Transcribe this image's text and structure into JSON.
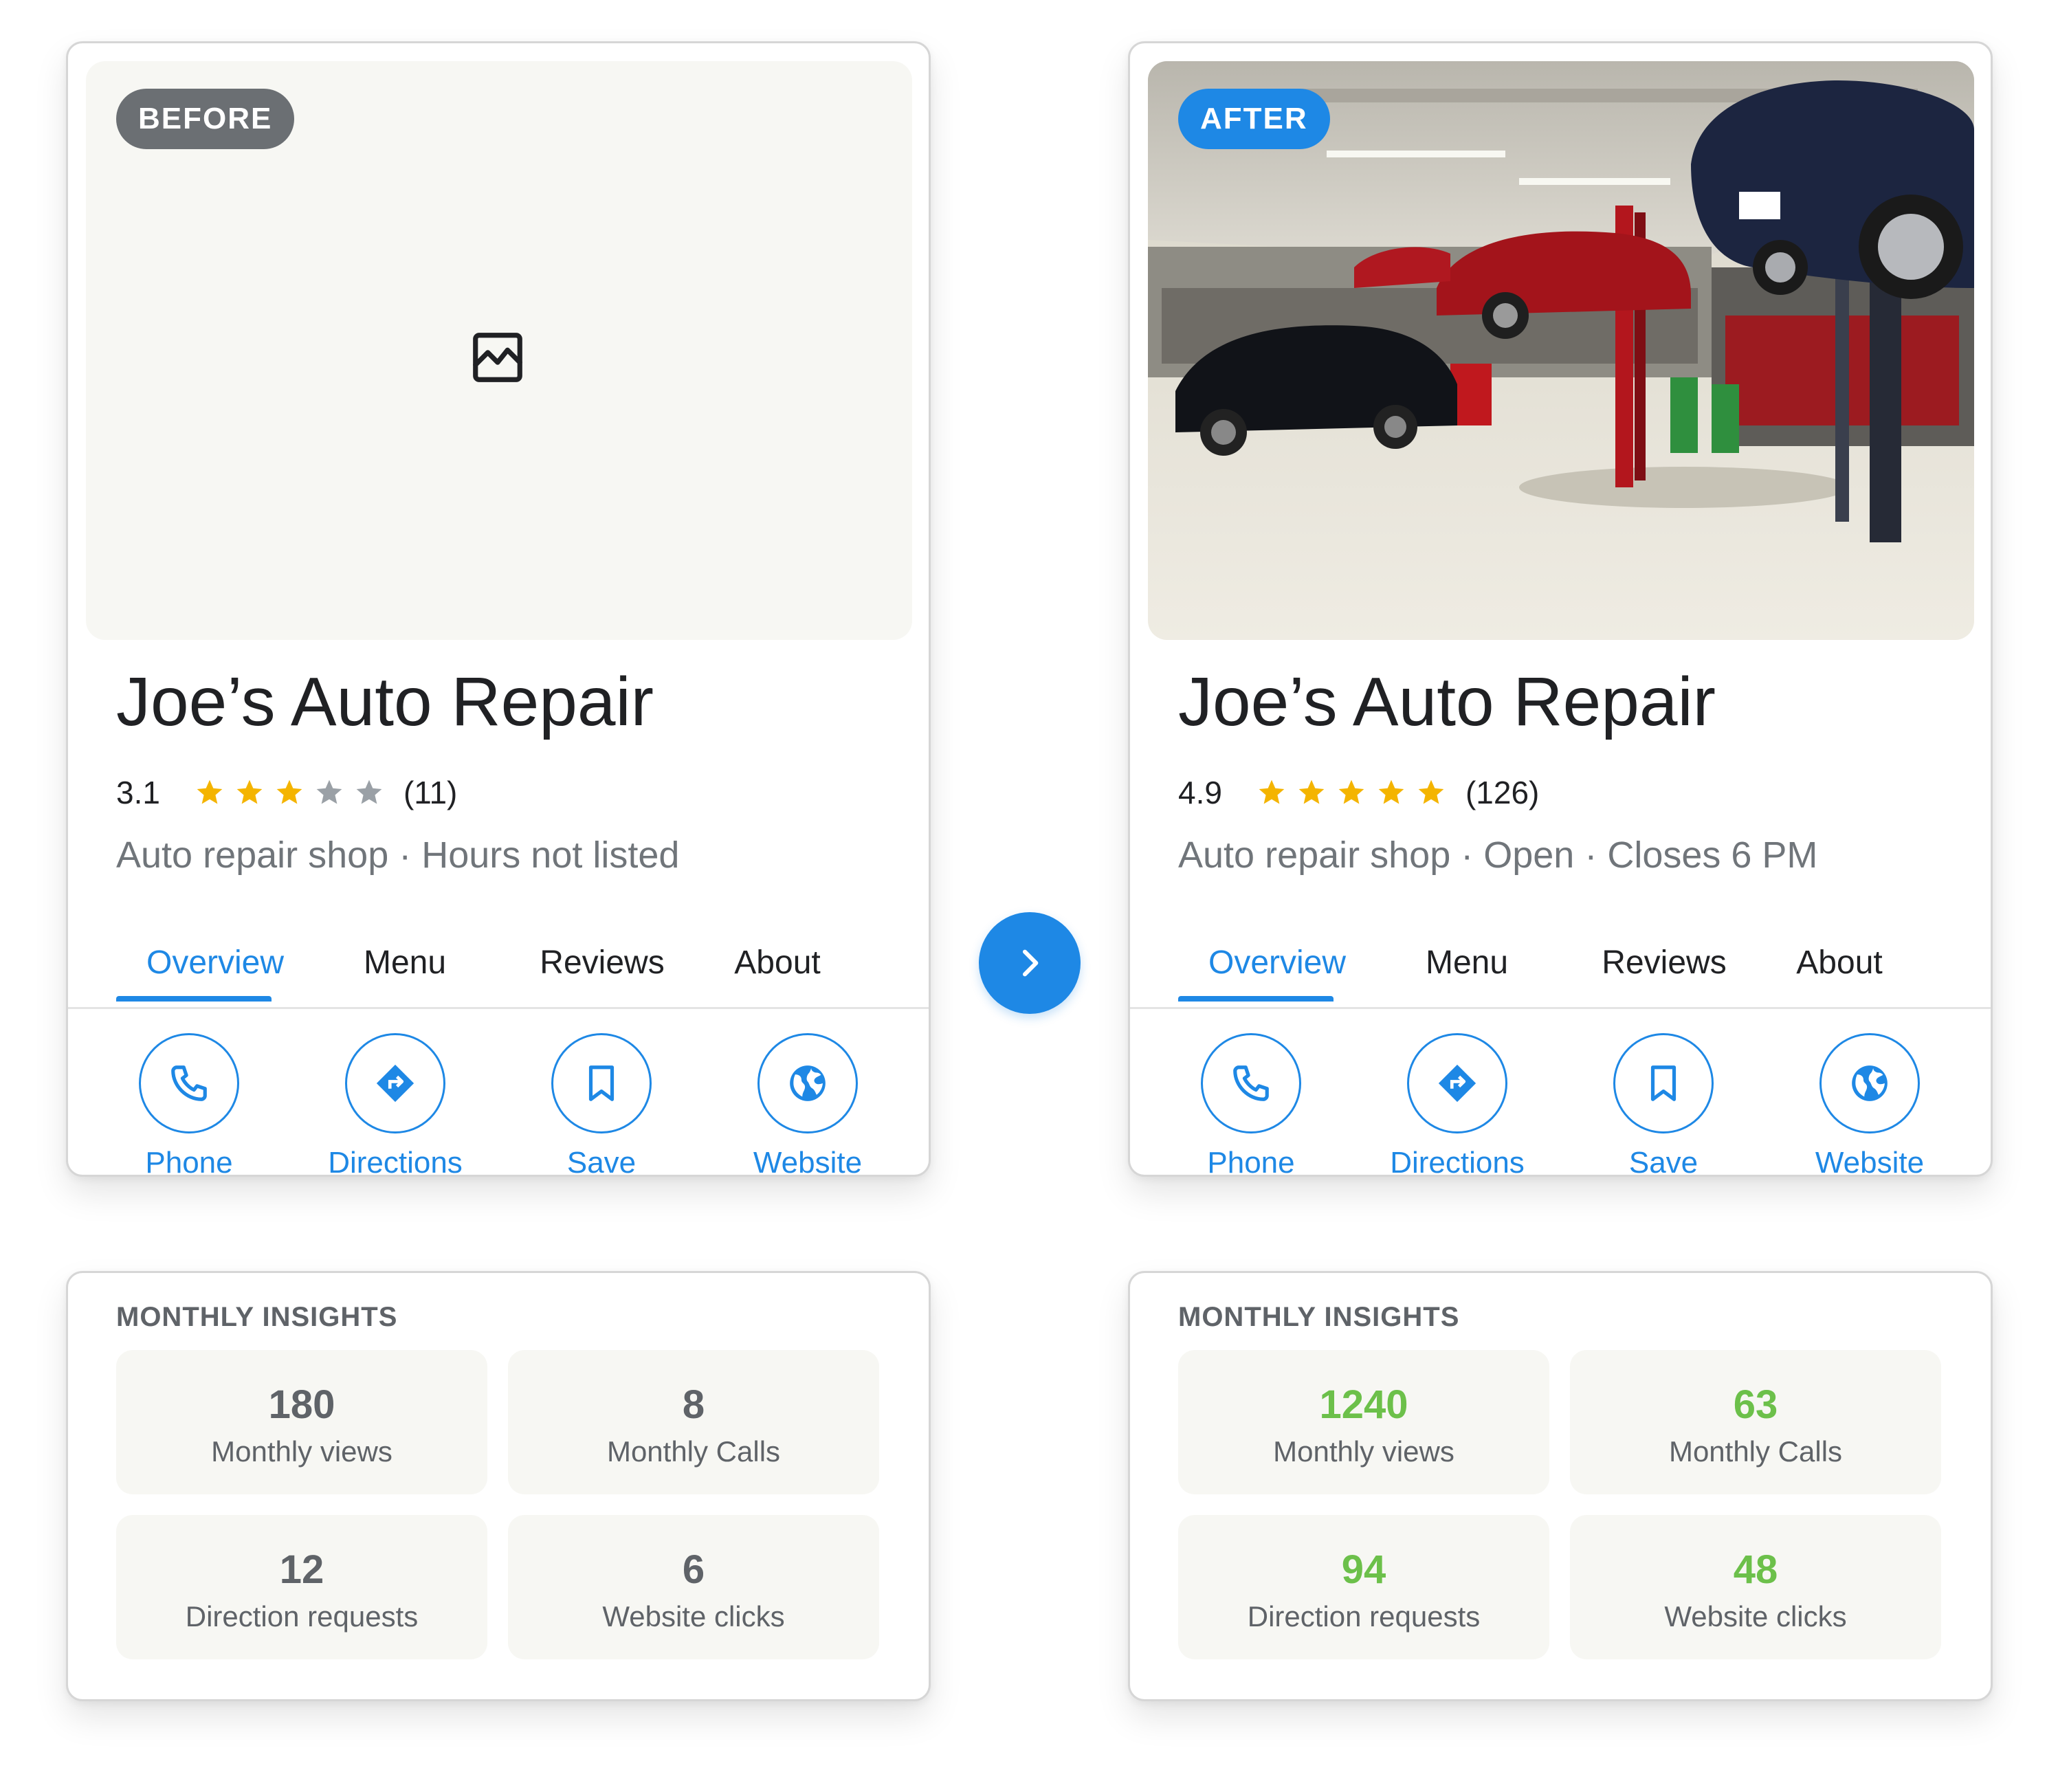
{
  "colors": {
    "accent": "#1e88e5",
    "star_filled": "#f4b400",
    "star_empty": "#9aa0a6",
    "before_badge": "#6b6f73",
    "after_value": "#6cc04a",
    "before_value": "#5f6368"
  },
  "before": {
    "badge": "BEFORE",
    "hero_icon": "broken-image-icon",
    "business_name": "Joe’s Auto Repair",
    "rating": "3.1",
    "stars_filled": 3,
    "stars_total": 5,
    "review_count": "(11)",
    "subtitle": "Auto repair shop · Hours not listed",
    "tabs": [
      "Overview",
      "Menu",
      "Reviews",
      "About"
    ],
    "active_tab": "Overview",
    "actions": [
      {
        "label": "Phone",
        "icon": "phone-icon"
      },
      {
        "label": "Directions",
        "icon": "directions-icon"
      },
      {
        "label": "Save",
        "icon": "bookmark-icon"
      },
      {
        "label": "Website",
        "icon": "globe-icon"
      }
    ],
    "insights": {
      "title": "MONTHLY INSIGHTS",
      "metrics": [
        {
          "value": "180",
          "label": "Monthly views"
        },
        {
          "value": "8",
          "label": "Monthly Calls"
        },
        {
          "value": "12",
          "label": "Direction requests"
        },
        {
          "value": "6",
          "label": "Website clicks"
        }
      ]
    }
  },
  "after": {
    "badge": "AFTER",
    "hero_image": "auto-repair-garage-photo",
    "business_name": "Joe’s Auto Repair",
    "rating": "4.9",
    "stars_filled": 5,
    "stars_total": 5,
    "review_count": "(126)",
    "subtitle": "Auto repair shop · Open · Closes 6 PM",
    "tabs": [
      "Overview",
      "Menu",
      "Reviews",
      "About"
    ],
    "active_tab": "Overview",
    "actions": [
      {
        "label": "Phone",
        "icon": "phone-icon"
      },
      {
        "label": "Directions",
        "icon": "directions-icon"
      },
      {
        "label": "Save",
        "icon": "bookmark-icon"
      },
      {
        "label": "Website",
        "icon": "globe-icon"
      }
    ],
    "insights": {
      "title": "MONTHLY INSIGHTS",
      "metrics": [
        {
          "value": "1240",
          "label": "Monthly views"
        },
        {
          "value": "63",
          "label": "Monthly Calls"
        },
        {
          "value": "94",
          "label": "Direction requests"
        },
        {
          "value": "48",
          "label": "Website clicks"
        }
      ]
    }
  },
  "arrow_icon": "chevron-right-icon"
}
